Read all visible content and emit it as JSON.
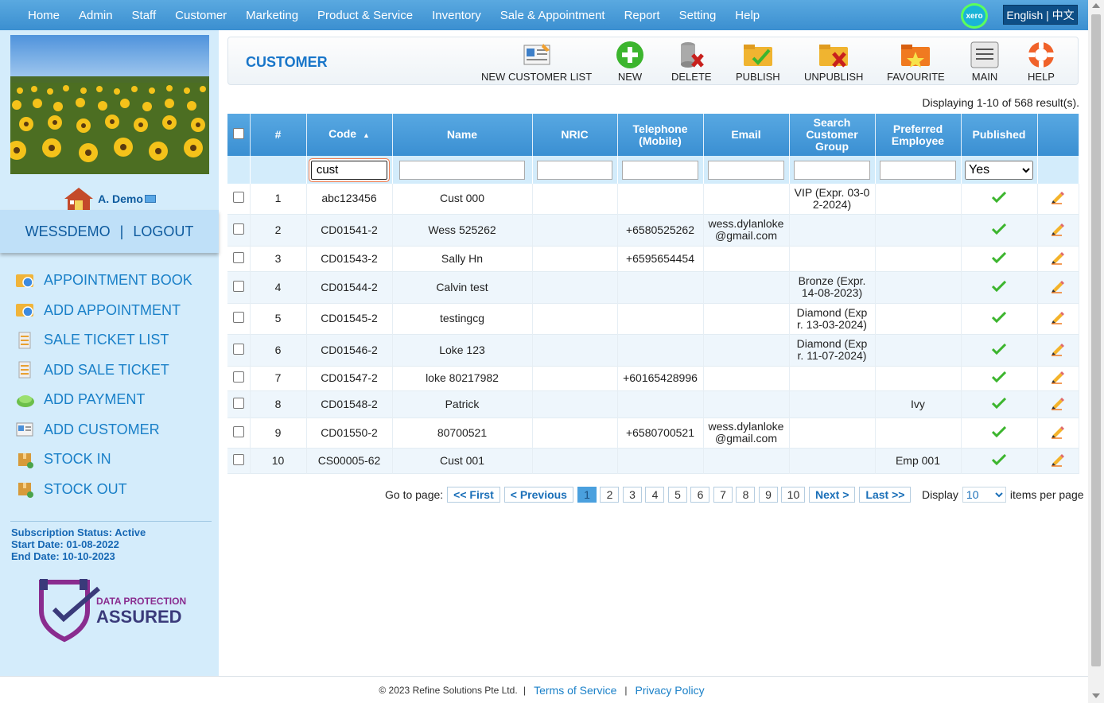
{
  "topnav": {
    "items": [
      "Home",
      "Admin",
      "Staff",
      "Customer",
      "Marketing",
      "Product & Service",
      "Inventory",
      "Sale & Appointment",
      "Report",
      "Setting",
      "Help"
    ],
    "xero_label": "xero",
    "language": "English | 中文"
  },
  "sidebar": {
    "user_name": "A. Demo",
    "account": "WESSDEMO",
    "logout": "LOGOUT",
    "menu": [
      "APPOINTMENT BOOK",
      "ADD APPOINTMENT",
      "SALE TICKET LIST",
      "ADD SALE TICKET",
      "ADD PAYMENT",
      "ADD CUSTOMER",
      "STOCK IN",
      "STOCK OUT"
    ],
    "subscription_status": "Subscription Status: Active",
    "start_date": "Start Date: 01-08-2022",
    "end_date": "End Date: 10-10-2023",
    "dpa_line1": "DATA PROTECTION",
    "dpa_line2": "ASSURED"
  },
  "toolbar": {
    "title": "CUSTOMER",
    "buttons": [
      "NEW CUSTOMER LIST",
      "NEW",
      "DELETE",
      "PUBLISH",
      "UNPUBLISH",
      "FAVOURITE",
      "MAIN",
      "HELP"
    ]
  },
  "result_count": "Displaying 1-10 of 568 result(s).",
  "grid": {
    "headers": {
      "num": "#",
      "code": "Code",
      "name": "Name",
      "nric": "NRIC",
      "telephone": "Telephone (Mobile)",
      "email": "Email",
      "group": "Search Customer Group",
      "employee": "Preferred Employee",
      "published": "Published"
    },
    "sort_indicator": "▲",
    "filter": {
      "code": "cust",
      "published": "Yes"
    },
    "rows": [
      {
        "num": "1",
        "code": "abc123456",
        "name": "Cust 000",
        "nric": "",
        "tel": "",
        "email": "",
        "group": "VIP (Expr. 03-02-2024)",
        "employee": ""
      },
      {
        "num": "2",
        "code": "CD01541-2",
        "name": "Wess 525262",
        "nric": "",
        "tel": "+6580525262",
        "email": "wess.dylanloke@gmail.com",
        "group": "",
        "employee": ""
      },
      {
        "num": "3",
        "code": "CD01543-2",
        "name": "Sally Hn",
        "nric": "",
        "tel": "+6595654454",
        "email": "",
        "group": "",
        "employee": ""
      },
      {
        "num": "4",
        "code": "CD01544-2",
        "name": "Calvin test",
        "nric": "",
        "tel": "",
        "email": "",
        "group": "Bronze (Expr. 14-08-2023)",
        "employee": ""
      },
      {
        "num": "5",
        "code": "CD01545-2",
        "name": "testingcg",
        "nric": "",
        "tel": "",
        "email": "",
        "group": "Diamond (Expr. 13-03-2024)",
        "employee": ""
      },
      {
        "num": "6",
        "code": "CD01546-2",
        "name": "Loke 123",
        "nric": "",
        "tel": "",
        "email": "",
        "group": "Diamond (Expr. 11-07-2024)",
        "employee": ""
      },
      {
        "num": "7",
        "code": "CD01547-2",
        "name": "loke 80217982",
        "nric": "",
        "tel": "+60165428996",
        "email": "",
        "group": "",
        "employee": ""
      },
      {
        "num": "8",
        "code": "CD01548-2",
        "name": "Patrick",
        "nric": "",
        "tel": "",
        "email": "",
        "group": "",
        "employee": "Ivy"
      },
      {
        "num": "9",
        "code": "CD01550-2",
        "name": "80700521",
        "nric": "",
        "tel": "+6580700521",
        "email": "wess.dylanloke@gmail.com",
        "group": "",
        "employee": ""
      },
      {
        "num": "10",
        "code": "CS00005-62",
        "name": "Cust 001",
        "nric": "",
        "tel": "",
        "email": "",
        "group": "",
        "employee": "Emp 001"
      }
    ]
  },
  "pager": {
    "go_to": "Go to page:",
    "first": "<< First",
    "previous": "< Previous",
    "pages": [
      "1",
      "2",
      "3",
      "4",
      "5",
      "6",
      "7",
      "8",
      "9",
      "10"
    ],
    "next": "Next >",
    "last": "Last >>",
    "display": "Display",
    "per_page_value": "10",
    "items_per_page": "items per page"
  },
  "footer": {
    "copyright": "© 2023 Refine Solutions Pte Ltd.",
    "terms": "Terms of Service",
    "privacy": "Privacy Policy"
  },
  "colors": {
    "nav": "#3b8fd0",
    "accent": "#1a80c8",
    "sidebar_bg": "#d4ecfb",
    "focus_ring": "#f07a4d",
    "published_tick": "#3cb52e"
  }
}
